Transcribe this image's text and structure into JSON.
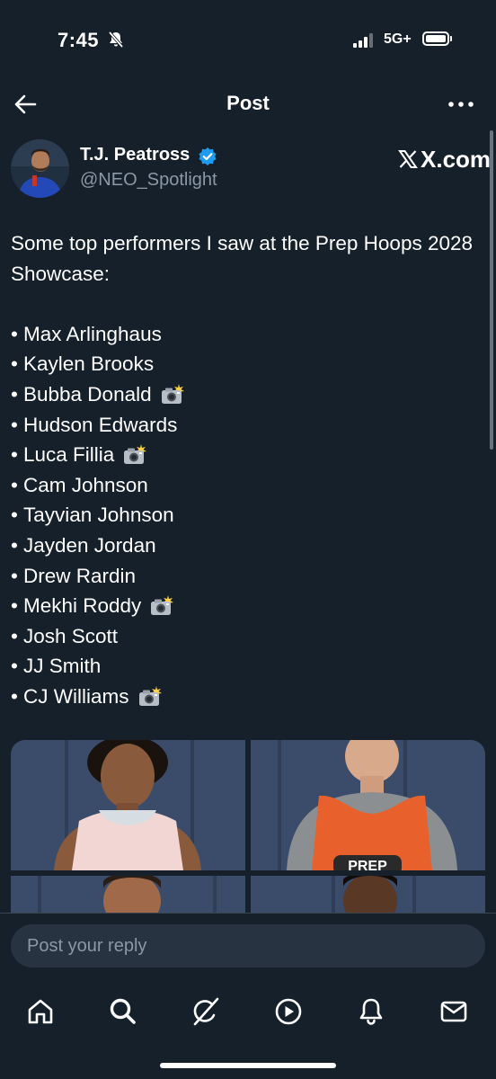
{
  "status_bar": {
    "time": "7:45",
    "network": "5G+"
  },
  "nav": {
    "title": "Post"
  },
  "author": {
    "name": "T.J. Peatross",
    "handle": "@NEO_Spotlight",
    "badge": "X.com"
  },
  "post": {
    "intro": "Some top performers I saw at the Prep Hoops 2028 Showcase:",
    "bullet": "•",
    "players": [
      {
        "name": "Max Arlinghaus",
        "camera": false
      },
      {
        "name": "Kaylen Brooks",
        "camera": false
      },
      {
        "name": "Bubba Donald",
        "camera": true
      },
      {
        "name": "Hudson Edwards",
        "camera": false
      },
      {
        "name": "Luca Fillia",
        "camera": true
      },
      {
        "name": "Cam Johnson",
        "camera": false
      },
      {
        "name": "Tayvian Johnson",
        "camera": false
      },
      {
        "name": "Jayden Jordan",
        "camera": false
      },
      {
        "name": "Drew Rardin",
        "camera": false
      },
      {
        "name": "Mekhi Roddy",
        "camera": true
      },
      {
        "name": "Josh Scott",
        "camera": false
      },
      {
        "name": "JJ Smith",
        "camera": false
      },
      {
        "name": "CJ Williams",
        "camera": true
      }
    ],
    "jersey_text": "PREP"
  },
  "reply": {
    "placeholder": "Post your reply"
  },
  "tabs": [
    {
      "icon": "home-icon"
    },
    {
      "icon": "search-icon"
    },
    {
      "icon": "grok-icon"
    },
    {
      "icon": "video-icon"
    },
    {
      "icon": "notifications-icon"
    },
    {
      "icon": "messages-icon"
    }
  ],
  "colors": {
    "background": "#15202b",
    "text": "#ffffff",
    "muted": "#8b98a5",
    "verified": "#1d9bf0",
    "input": "#273340",
    "jersey": "#e8612c"
  }
}
